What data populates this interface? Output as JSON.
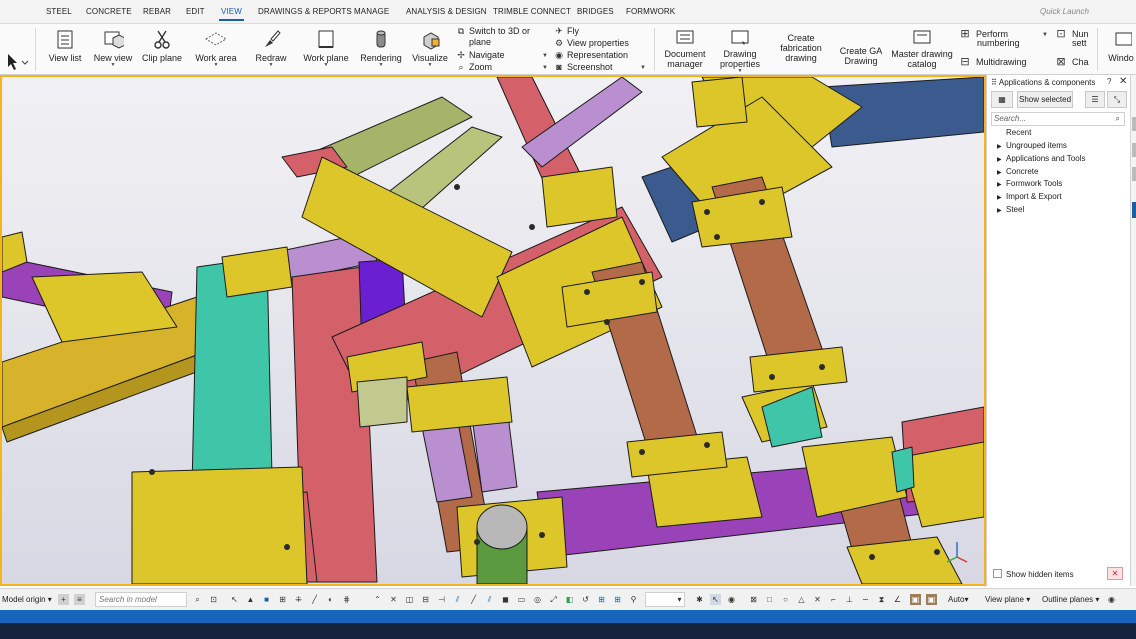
{
  "menu": {
    "tabs": [
      "STEEL",
      "CONCRETE",
      "REBAR",
      "EDIT",
      "VIEW",
      "DRAWINGS & REPORTS",
      "MANAGE",
      "ANALYSIS & DESIGN",
      "TRIMBLE CONNECT",
      "BRIDGES",
      "FORMWORK"
    ],
    "active_tab": "VIEW",
    "quick_launch_placeholder": "Quick Launch"
  },
  "ribbon": {
    "view_list": "View list",
    "new_view": "New view",
    "clip_plane": "Clip plane",
    "work_area": "Work area",
    "redraw": "Redraw",
    "work_plane": "Work plane",
    "rendering": "Rendering",
    "visualize": "Visualize",
    "switch_3d_line1": "Switch to 3D or",
    "switch_3d_line2": "plane",
    "navigate": "Navigate",
    "zoom": "Zoom",
    "fly": "Fly",
    "view_properties": "View properties",
    "representation": "Representation",
    "screenshot": "Screenshot",
    "document_manager_line1": "Document",
    "document_manager_line2": "manager",
    "drawing_properties_line1": "Drawing",
    "drawing_properties_line2": "properties",
    "create_fab_line1": "Create",
    "create_fab_line2": "fabrication",
    "create_fab_line3": "drawing",
    "create_ga_line1": "Create GA",
    "create_ga_line2": "Drawing",
    "master_catalog_line1": "Master drawing",
    "master_catalog_line2": "catalog",
    "perform_numbering_line1": "Perform",
    "perform_numbering_line2": "numbering",
    "multidrawing": "Multidrawing",
    "num_settings_line1": "Nun",
    "num_settings_line2": "sett",
    "change": "Cha",
    "window": "Windo"
  },
  "panel": {
    "title": "Applications & components",
    "show_selected": "Show selected",
    "search_placeholder": "Search...",
    "tree": [
      {
        "label": "Recent",
        "expandable": false
      },
      {
        "label": "Ungrouped items",
        "expandable": true
      },
      {
        "label": "Applications and Tools",
        "expandable": true
      },
      {
        "label": "Concrete",
        "expandable": true
      },
      {
        "label": "Formwork Tools",
        "expandable": true
      },
      {
        "label": "Import & Export",
        "expandable": true
      },
      {
        "label": "Steel",
        "expandable": true
      }
    ],
    "show_hidden": "Show hidden items"
  },
  "bottombar": {
    "model_origin": "Model origin",
    "search_placeholder": "Search in model",
    "auto": "Auto",
    "view_plane": "View plane",
    "outline_planes": "Outline planes"
  },
  "colors": {
    "viewport_border": "#f2b51a",
    "active_tab": "#1a5ea8",
    "beam_yellow": "#dcc62a",
    "beam_pink": "#d4606a",
    "beam_purple": "#9a42b8",
    "beam_brown": "#b36a48",
    "beam_teal": "#3fc6a8",
    "beam_blue": "#3b5b8e",
    "beam_olive": "#a6b46a",
    "beam_lilac": "#b98fd0",
    "beam_violet": "#6a1fd0",
    "status_dark": "#14223d",
    "status_blue": "#1566bf"
  }
}
